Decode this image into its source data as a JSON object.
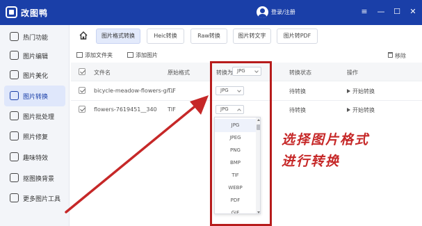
{
  "app": {
    "title": "改图鸭",
    "login_label": "登录/注册",
    "window_controls": [
      "≡",
      "—",
      "☐",
      "✕"
    ]
  },
  "sidebar": {
    "items": [
      {
        "label": "热门功能",
        "icon": "hot-icon"
      },
      {
        "label": "图片编辑",
        "icon": "edit-icon"
      },
      {
        "label": "图片美化",
        "icon": "beautify-icon"
      },
      {
        "label": "图片转换",
        "icon": "convert-icon"
      },
      {
        "label": "图片批处理",
        "icon": "batch-icon"
      },
      {
        "label": "照片修复",
        "icon": "repair-icon"
      },
      {
        "label": "趣味特效",
        "icon": "effects-icon"
      },
      {
        "label": "抠图换背景",
        "icon": "cutout-icon"
      },
      {
        "label": "更多图片工具",
        "icon": "more-tools-icon"
      }
    ],
    "active_index": 3
  },
  "tabs": [
    "图片格式转换",
    "Heic转换",
    "Raw转换",
    "图片转文字",
    "图片转PDF"
  ],
  "toolbar": {
    "add_folder": "添加文件夹",
    "add_image": "添加图片",
    "remove": "移除"
  },
  "table": {
    "headers": {
      "filename": "文件名",
      "original_format": "原始格式",
      "convert_to": "转换为",
      "convert_to_value": "JPG",
      "status": "转换状态",
      "action": "操作"
    },
    "rows": [
      {
        "filename": "bicycle-meadow-flowers-gr...",
        "format": "TIF",
        "target": "JPG",
        "status": "待转换",
        "action": "开始转换"
      },
      {
        "filename": "flowers-7619451__340",
        "format": "TIF",
        "target": "JPG",
        "status": "待转换",
        "action": "开始转换"
      }
    ]
  },
  "dropdown": {
    "options": [
      "JPG",
      "JPEG",
      "PNG",
      "BMP",
      "TIF",
      "WEBP",
      "PDF",
      "GIF"
    ],
    "selected": "JPG"
  },
  "annotation": {
    "line1": "选择图片格式",
    "line2": "进行转换",
    "color": "#c62828"
  },
  "colors": {
    "titlebar": "#1a3fa8",
    "highlight_box": "#b71c1c"
  }
}
